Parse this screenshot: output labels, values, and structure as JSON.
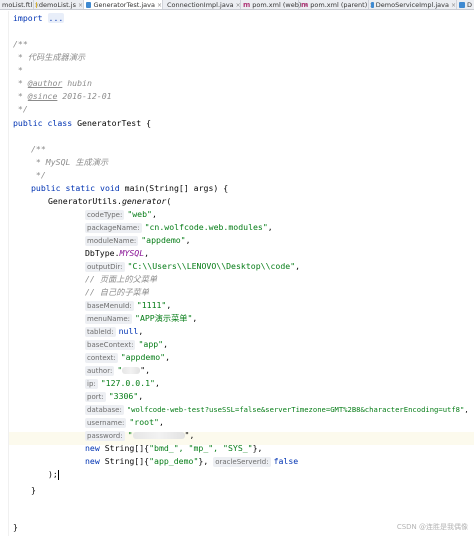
{
  "tabs": [
    {
      "label": "moList.ftl",
      "icon": "html-file-icon"
    },
    {
      "label": "demoList.js",
      "icon": "js-file-icon"
    },
    {
      "label": "GeneratorTest.java",
      "icon": "java-class-icon"
    },
    {
      "label": "ConnectionImpl.java",
      "icon": "java-class-icon"
    },
    {
      "label": "pom.xml (web)",
      "icon": "maven-icon"
    },
    {
      "label": "pom.xml (parent)",
      "icon": "maven-icon"
    },
    {
      "label": "DemoServiceImpl.java",
      "icon": "java-class-icon"
    },
    {
      "label": "D",
      "icon": "java-class-icon"
    }
  ],
  "tab_close": "×",
  "code": {
    "import_kw": "import",
    "import_fold": "...",
    "doc_open": "/**",
    "doc_title": " * 代码生成器演示",
    "doc_star": " *",
    "author_tag": "@author",
    "author_val": " hubin",
    "since_tag": "@since",
    "since_val": " 2016-12-01",
    "doc_close": " */",
    "class_kw": "public class",
    "class_name": " GeneratorTest {",
    "m_doc_open": "/**",
    "m_doc_text": " * MySQL 生成演示",
    "m_doc_close": " */",
    "main_kw": "public static void",
    "main_sig": " main(String[] args) {",
    "call_prefix": "GeneratorUtils.",
    "call_method": "generator",
    "call_paren": "(",
    "args": [
      {
        "hint": "codeType:",
        "value": "\"web\"",
        "suffix": ","
      },
      {
        "hint": "packageName:",
        "value": "\"cn.wolfcode.web.modules\"",
        "suffix": ","
      },
      {
        "hint": "moduleName:",
        "value": "\"appdemo\"",
        "suffix": ","
      }
    ],
    "dbtype_prefix": "DbType.",
    "dbtype_const": "MYSQL",
    "dbtype_suffix": ",",
    "outputdir_hint": "outputDir:",
    "outputdir_val": "\"C:\\\\Users\\\\LENOVO\\\\Desktop\\\\code\"",
    "outputdir_suffix": ",",
    "comment1": "// 页面上的父菜单",
    "comment2": "// 自己的子菜单",
    "args2": [
      {
        "hint": "baseMenuId:",
        "value": "\"1111\"",
        "suffix": ","
      },
      {
        "hint": "menuName:",
        "value": "\"APP演示菜单\"",
        "suffix": ","
      }
    ],
    "tableid_hint": "tableId:",
    "tableid_val": "null",
    "tableid_suffix": ",",
    "args3": [
      {
        "hint": "baseContext:",
        "value": "\"app\"",
        "suffix": ","
      },
      {
        "hint": "context:",
        "value": "\"appdemo\"",
        "suffix": ","
      }
    ],
    "author_hint": "author:",
    "author_q1": "\"",
    "author_q2": "\",",
    "args4": [
      {
        "hint": "ip:",
        "value": "\"127.0.0.1\"",
        "suffix": ","
      },
      {
        "hint": "port:",
        "value": "\"3306\"",
        "suffix": ","
      },
      {
        "hint": "database:",
        "value": "\"wolfcode-web-test?useSSL=false&serverTimezone=GMT%2B8&characterEncoding=utf8\"",
        "suffix": ","
      },
      {
        "hint": "username:",
        "value": "\"root\"",
        "suffix": ","
      }
    ],
    "password_hint": "password:",
    "password_q1": "\"",
    "password_q2": "\",",
    "new_kw": "new",
    "arr1_type": " String[]{",
    "arr1_vals": "\"bmd_\", \"mp_\", \"SYS_\"",
    "arr1_close": "},",
    "arr2_type": " String[]{",
    "arr2_val": "\"app_demo\"",
    "arr2_close": "},",
    "oracle_hint": "oracleServerId:",
    "oracle_val": "false",
    "close_call": ");",
    "close_brace": "}"
  },
  "watermark": "CSDN @连胜是我偶像"
}
